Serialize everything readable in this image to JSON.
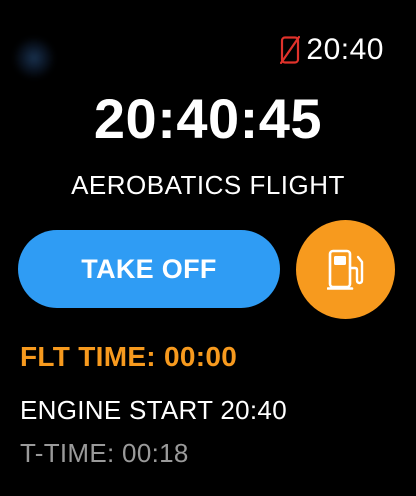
{
  "status_bar": {
    "time": "20:40",
    "phone_icon": "phone-disconnected-icon",
    "phone_icon_color": "#e0322b"
  },
  "clock": {
    "time": "20:40:45"
  },
  "flight": {
    "title": "AEROBATICS FLIGHT"
  },
  "actions": {
    "takeoff_label": "TAKE OFF",
    "takeoff_color": "#2f9cf4",
    "fuel_icon": "fuel-pump-icon",
    "fuel_color": "#f79a1e"
  },
  "info": {
    "flt_time": "FLT TIME: 00:00",
    "engine_start": "ENGINE START 20:40",
    "t_time": "T-TIME: 00:18"
  },
  "colors": {
    "background": "#000000",
    "accent_orange": "#f79a1e",
    "accent_blue": "#2f9cf4",
    "secondary_text": "#9a9a9a"
  }
}
